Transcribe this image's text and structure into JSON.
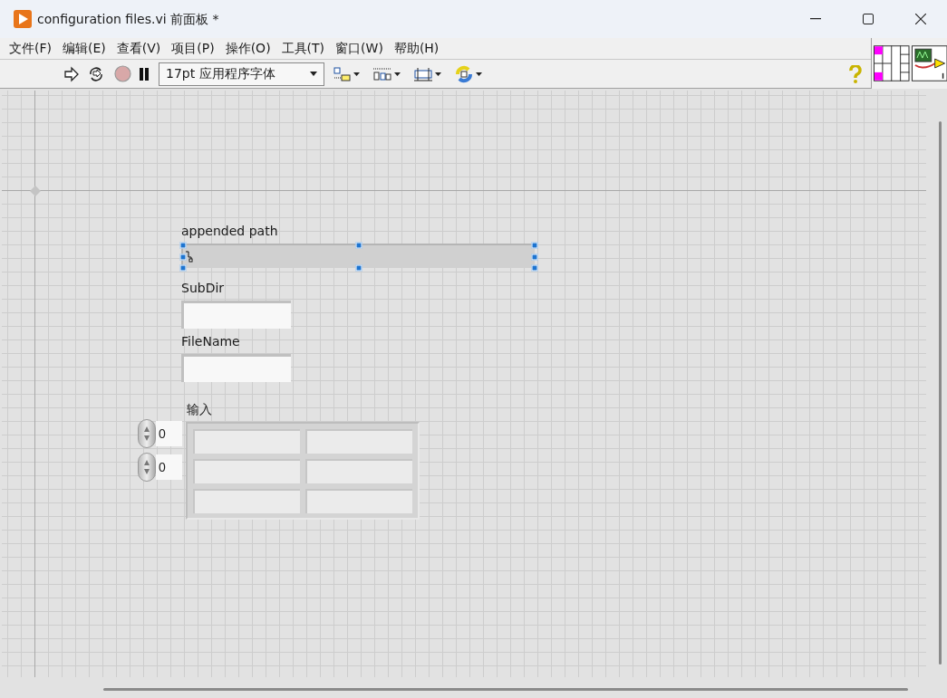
{
  "window": {
    "title": "configuration files.vi 前面板 *"
  },
  "menu": [
    {
      "label": "文件(F)"
    },
    {
      "label": "编辑(E)"
    },
    {
      "label": "查看(V)"
    },
    {
      "label": "项目(P)"
    },
    {
      "label": "操作(O)"
    },
    {
      "label": "工具(T)"
    },
    {
      "label": "窗口(W)"
    },
    {
      "label": "帮助(H)"
    }
  ],
  "toolbar": {
    "font_select": "17pt 应用程序字体",
    "abort_disabled": true
  },
  "controls": [
    {
      "kind": "path",
      "label": "appended path",
      "selected": true
    },
    {
      "kind": "string",
      "label": "SubDir",
      "selected": false
    },
    {
      "kind": "string",
      "label": "FileName",
      "selected": false
    },
    {
      "kind": "array2d",
      "label": "输入",
      "selected": false,
      "indices": [
        "0",
        "0"
      ]
    }
  ]
}
